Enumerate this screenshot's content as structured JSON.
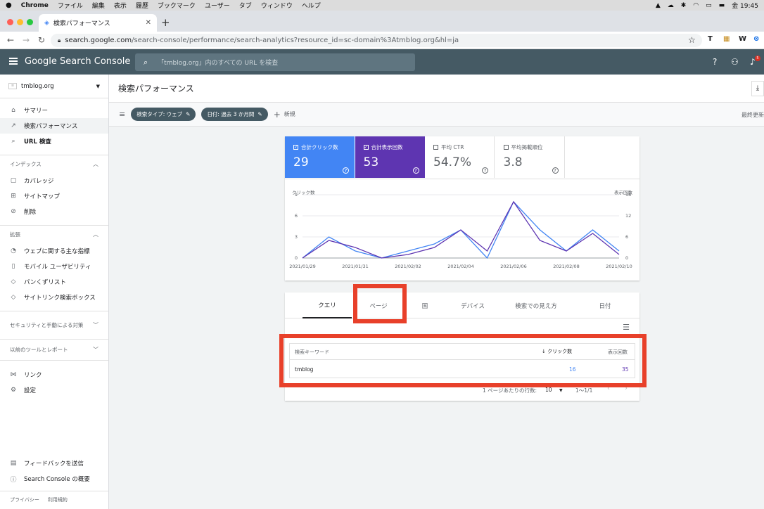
{
  "mac_menu": {
    "apple": "",
    "app": "Chrome",
    "items": [
      "ファイル",
      "編集",
      "表示",
      "履歴",
      "ブックマーク",
      "ユーザー",
      "タブ",
      "ウィンドウ",
      "ヘルプ"
    ],
    "clock": "金 19:45"
  },
  "browser": {
    "tab_title": "検索パフォーマンス",
    "url_host": "search.google.com",
    "url_path": "/search-console/performance/search-analytics?resource_id=sc-domain%3Atmblog.org&hl=ja"
  },
  "header": {
    "product": "Google Search Console",
    "search_placeholder": "「tmblog.org」内のすべての URL を検査",
    "notification_count": "5"
  },
  "sidebar": {
    "property": "tmblog.org",
    "items_top": [
      {
        "label": "サマリー",
        "icon": "home-icon"
      },
      {
        "label": "検索パフォーマンス",
        "icon": "trending-icon"
      },
      {
        "label": "URL 検査",
        "icon": "search-icon"
      }
    ],
    "section_index": "インデックス",
    "items_index": [
      {
        "label": "カバレッジ",
        "icon": "file-icon"
      },
      {
        "label": "サイトマップ",
        "icon": "sitemap-icon"
      },
      {
        "label": "削除",
        "icon": "eye-off-icon"
      }
    ],
    "section_enhance": "拡張",
    "items_enhance": [
      {
        "label": "ウェブに関する主な指標",
        "icon": "gauge-icon"
      },
      {
        "label": "モバイル ユーザビリティ",
        "icon": "phone-icon"
      },
      {
        "label": "パンくずリスト",
        "icon": "layers-icon"
      },
      {
        "label": "サイトリンク検索ボックス",
        "icon": "layers-icon"
      }
    ],
    "section_security": "セキュリティと手動による対策",
    "section_legacy": "以前のツールとレポート",
    "items_bottom": [
      {
        "label": "リンク",
        "icon": "links-icon"
      },
      {
        "label": "設定",
        "icon": "gear-icon"
      }
    ],
    "feedback": "フィードバックを送信",
    "about": "Search Console の概要",
    "privacy": "プライバシー",
    "terms": "利用規約"
  },
  "page": {
    "title": "検索パフォーマンス",
    "filter_type": "検索タイプ: ウェブ",
    "filter_date": "日付: 過去 3 か月間",
    "new_label": "新規",
    "last_updated": "最終更新"
  },
  "metrics": [
    {
      "label": "合計クリック数",
      "value": "29",
      "checked": true,
      "bg": "#4285f4",
      "color": "#ffffff"
    },
    {
      "label": "合計表示回数",
      "value": "53",
      "checked": true,
      "bg": "#5e35b1",
      "color": "#ffffff"
    },
    {
      "label": "平均 CTR",
      "value": "54.7%",
      "checked": false,
      "bg": "#ffffff",
      "color": "#5f6368"
    },
    {
      "label": "平均掲載順位",
      "value": "3.8",
      "checked": false,
      "bg": "#ffffff",
      "color": "#5f6368"
    }
  ],
  "chart_data": {
    "type": "line",
    "left_axis_label": "クリック数",
    "right_axis_label": "表示回数",
    "left_ticks": [
      "0",
      "3",
      "6",
      "9"
    ],
    "right_ticks": [
      "0",
      "6",
      "12",
      "18"
    ],
    "left_ylim": [
      0,
      9
    ],
    "right_ylim": [
      0,
      18
    ],
    "x_labels": [
      "2021/01/29",
      "2021/01/31",
      "2021/02/02",
      "2021/02/04",
      "2021/02/06",
      "2021/02/08",
      "2021/02/10"
    ],
    "x_range": [
      "2021/01/29",
      "2021/02/10"
    ],
    "series": [
      {
        "name": "合計クリック数",
        "axis": "left",
        "color": "#4285f4",
        "x": [
          "2021/01/29",
          "2021/01/30",
          "2021/01/31",
          "2021/02/01",
          "2021/02/02",
          "2021/02/03",
          "2021/02/04",
          "2021/02/05",
          "2021/02/06",
          "2021/02/07",
          "2021/02/08",
          "2021/02/09",
          "2021/02/10"
        ],
        "values": [
          0,
          3,
          1,
          0,
          1,
          2,
          4,
          0,
          8,
          4,
          1,
          4,
          1
        ]
      },
      {
        "name": "合計表示回数",
        "axis": "right",
        "color": "#5e35b1",
        "x": [
          "2021/01/29",
          "2021/01/30",
          "2021/01/31",
          "2021/02/01",
          "2021/02/02",
          "2021/02/03",
          "2021/02/04",
          "2021/02/05",
          "2021/02/06",
          "2021/02/07",
          "2021/02/08",
          "2021/02/09",
          "2021/02/10"
        ],
        "values": [
          0,
          5,
          3,
          0,
          1,
          3,
          8,
          2,
          16,
          5,
          2,
          7,
          1
        ]
      }
    ]
  },
  "tabs": [
    "クエリ",
    "ページ",
    "国",
    "デバイス",
    "検索での見え方",
    "日付"
  ],
  "table": {
    "col_query": "検索キーワード",
    "col_clicks": "クリック数",
    "col_impressions": "表示回数",
    "rows": [
      {
        "query": "tmblog",
        "clicks": "16",
        "impressions": "35"
      }
    ]
  },
  "pagination": {
    "rows_label": "1 ページあたりの行数:",
    "rows_value": "10",
    "range": "1～1/1"
  },
  "colors": {
    "annotation": "#e8402a",
    "clicks": "#4285f4",
    "impressions": "#5e35b1"
  }
}
